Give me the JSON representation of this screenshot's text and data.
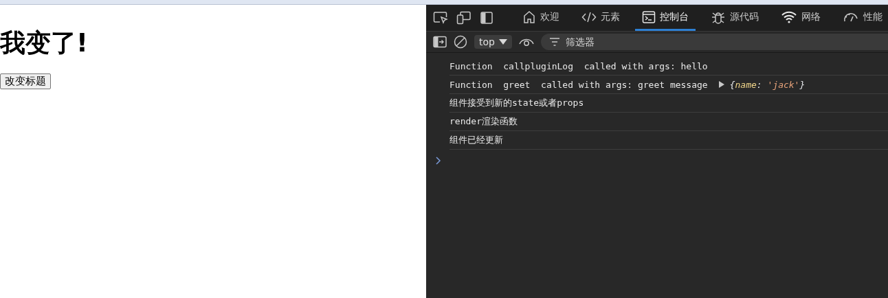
{
  "page": {
    "heading": "我变了!",
    "button": "改变标题"
  },
  "devtools": {
    "tool_icons": [
      {
        "kind": "inspect"
      },
      {
        "kind": "device"
      },
      {
        "kind": "dock"
      }
    ],
    "tabs": [
      {
        "kind": "home",
        "label": "欢迎",
        "selected": false
      },
      {
        "kind": "code",
        "label": "元素",
        "selected": false
      },
      {
        "kind": "console",
        "label": "控制台",
        "selected": true
      },
      {
        "kind": "bug",
        "label": "源代码",
        "selected": false
      },
      {
        "kind": "wifi",
        "label": "网络",
        "selected": false
      },
      {
        "kind": "gauge",
        "label": "性能",
        "selected": false
      }
    ],
    "context": "top",
    "filter_placeholder": "筛选器",
    "messages": [
      {
        "text": "Function  callpluginLog  called with args: hello"
      },
      {
        "text": "Function  greet  called with args: greet message",
        "preview": [
          {
            "text": "{",
            "kind": "punct"
          },
          {
            "text": "name",
            "kind": "key"
          },
          {
            "text": ": ",
            "kind": "punct"
          },
          {
            "text": "'jack'",
            "kind": "string"
          },
          {
            "text": "}",
            "kind": "punct"
          }
        ]
      },
      {
        "text": "组件接受到新的state或者props"
      },
      {
        "text": "render渲染函数"
      },
      {
        "text": "组件已经更新"
      }
    ]
  }
}
